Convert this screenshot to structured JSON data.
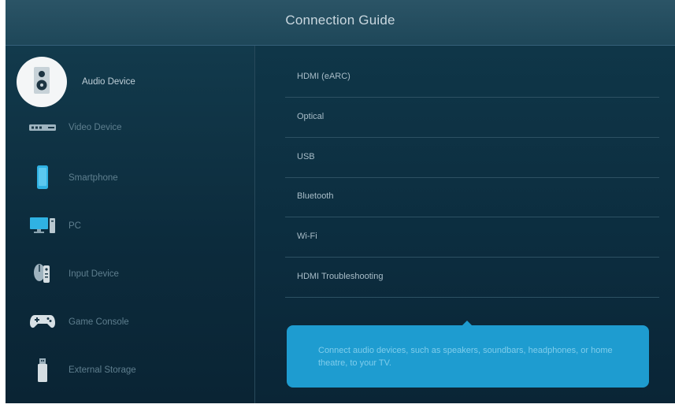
{
  "window": {
    "title": "Connection Guide"
  },
  "categories": [
    {
      "label": "Audio Device",
      "icon": "speaker-icon",
      "selected": true
    },
    {
      "label": "Video Device",
      "icon": "video-device-icon",
      "selected": false
    },
    {
      "label": "Smartphone",
      "icon": "smartphone-icon",
      "selected": false
    },
    {
      "label": "PC",
      "icon": "pc-icon",
      "selected": false
    },
    {
      "label": "Input Device",
      "icon": "input-device-icon",
      "selected": false
    },
    {
      "label": "Game Console",
      "icon": "gamepad-icon",
      "selected": false
    },
    {
      "label": "External Storage",
      "icon": "usb-storage-icon",
      "selected": false
    }
  ],
  "options": [
    {
      "label": "HDMI (eARC)"
    },
    {
      "label": "Optical"
    },
    {
      "label": "USB"
    },
    {
      "label": "Bluetooth"
    },
    {
      "label": "Wi-Fi"
    },
    {
      "label": "HDMI Troubleshooting"
    }
  ],
  "tooltip": {
    "text": "Connect audio devices, such as speakers, soundbars, headphones, or home theatre, to your TV."
  },
  "colors": {
    "background": "#0c2d3f",
    "titlebar": "#244d60",
    "tooltip": "#1e9cd0",
    "selected_circle": "#f4f6f7"
  }
}
